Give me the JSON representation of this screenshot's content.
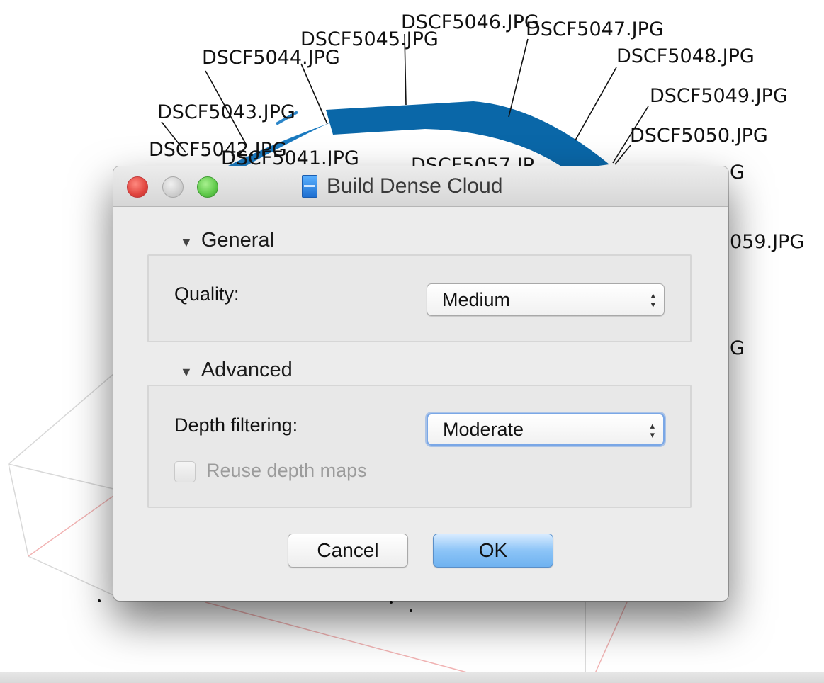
{
  "background": {
    "camera_labels": [
      "DSCF5046.JPG",
      "DSCF5047.JPG",
      "DSCF5045.JPG",
      "DSCF5044.JPG",
      "DSCF5048.JPG",
      "DSCF5049.JPG",
      "DSCF5043.JPG",
      "DSCF5050.JPG",
      "DSCF5042.JPG",
      "DSCF5041.JPG",
      "DSCF5057.JP",
      "G",
      "059.JPG",
      "G"
    ],
    "track_color": "#0a67a8"
  },
  "dialog": {
    "title": "Build Dense Cloud",
    "general": {
      "header": "General",
      "quality_label": "Quality:",
      "quality_value": "Medium"
    },
    "advanced": {
      "header": "Advanced",
      "depth_label": "Depth filtering:",
      "depth_value": "Moderate",
      "reuse_label": "Reuse depth maps",
      "reuse_checked": false
    },
    "buttons": {
      "cancel": "Cancel",
      "ok": "OK"
    }
  }
}
